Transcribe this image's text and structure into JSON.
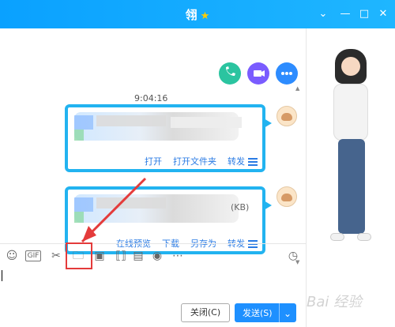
{
  "window": {
    "title": "翎",
    "title_badge": "★",
    "controls": {
      "min": "—",
      "max": "□",
      "close": "✕",
      "more": "⌄"
    }
  },
  "header_actions": [
    {
      "name": "voice-call",
      "icon": "phone-icon"
    },
    {
      "name": "video-call",
      "icon": "video-icon"
    },
    {
      "name": "more",
      "icon": "more-icon"
    }
  ],
  "timestamp": "9:04:16",
  "messages": [
    {
      "actions": [
        "打开",
        "打开文件夹",
        "转发"
      ],
      "menu_icon": "menu-icon"
    },
    {
      "file_size_suffix": "(KB)",
      "actions": [
        "在线预览",
        "下载",
        "另存为",
        "转发"
      ],
      "menu_icon": "menu-icon"
    }
  ],
  "toolbar": {
    "items": [
      {
        "name": "emoji",
        "icon": "smile-icon",
        "glyph": "☺"
      },
      {
        "name": "gif",
        "icon": "gif-icon",
        "glyph": "GIF"
      },
      {
        "name": "screenshot",
        "icon": "scissors-icon",
        "glyph": "✂"
      },
      {
        "name": "send-file",
        "icon": "folder-icon",
        "glyph": "🗀"
      },
      {
        "name": "image",
        "icon": "image-icon",
        "glyph": "▣"
      },
      {
        "name": "shake",
        "icon": "shake-icon",
        "glyph": "⟦⟧"
      },
      {
        "name": "calendar",
        "icon": "calendar-icon",
        "glyph": "▤"
      },
      {
        "name": "music",
        "icon": "music-icon",
        "glyph": "◉"
      },
      {
        "name": "more-tools",
        "icon": "more-icon",
        "glyph": "⋯"
      }
    ],
    "history_icon": "clock-icon",
    "history_glyph": "◷"
  },
  "footer": {
    "close_label": "关闭(C)",
    "send_label": "发送(S)",
    "send_dropdown_glyph": "⌄"
  },
  "watermark": "Bai 经验"
}
